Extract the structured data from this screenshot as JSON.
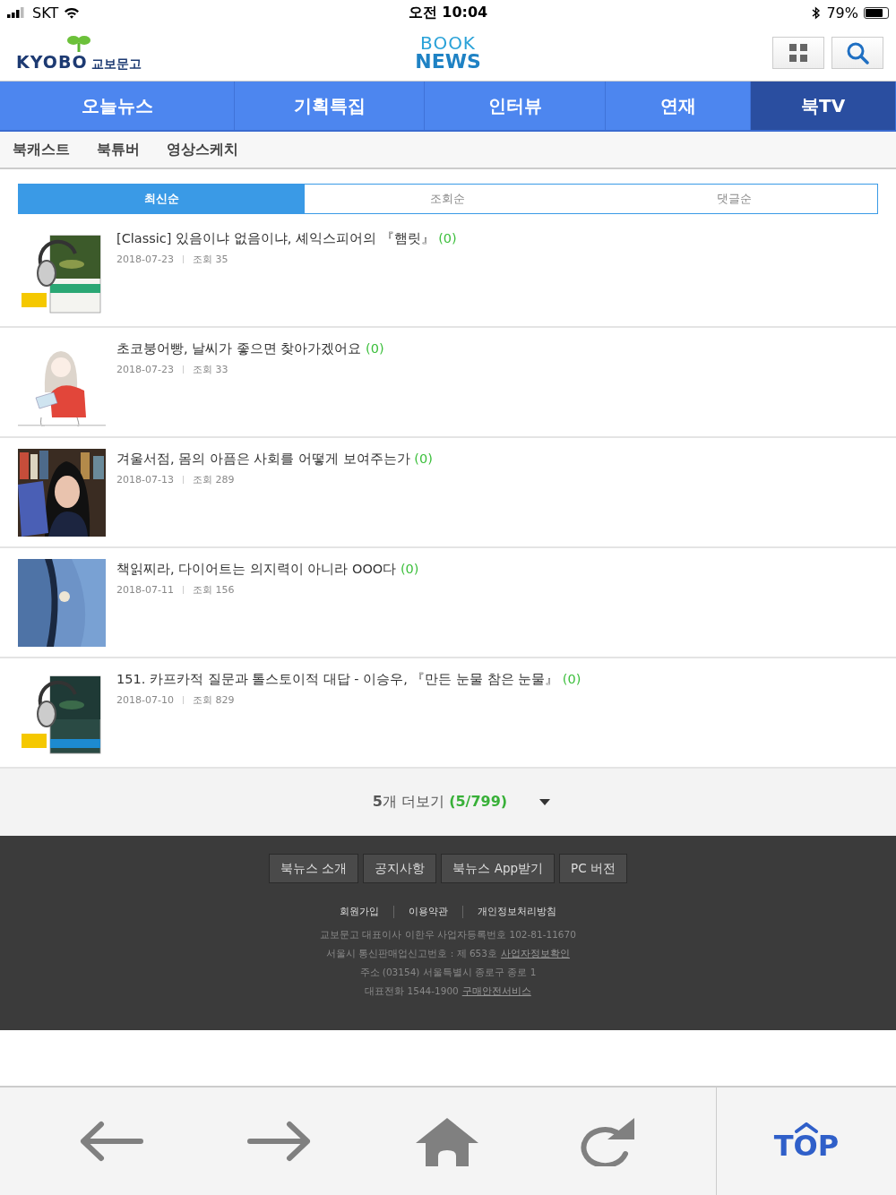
{
  "status_bar": {
    "carrier": "SKT",
    "time": "오전 10:04",
    "battery": "79%"
  },
  "header": {
    "logo_latin": "KYOBO",
    "logo_korean": "교보문고",
    "brand_top": "BOOK",
    "brand_bottom": "NEWS"
  },
  "nav_tabs": [
    {
      "label": "오늘뉴스",
      "selected": false
    },
    {
      "label": "기획특집",
      "selected": false
    },
    {
      "label": "인터뷰",
      "selected": false
    },
    {
      "label": "연재",
      "selected": false
    },
    {
      "label": "북TV",
      "selected": true
    }
  ],
  "sub_tabs": [
    "북캐스트",
    "북튜버",
    "영상스케치"
  ],
  "sort_tabs": [
    {
      "label": "최신순",
      "selected": true
    },
    {
      "label": "조회순",
      "selected": false
    },
    {
      "label": "댓글순",
      "selected": false
    }
  ],
  "articles": [
    {
      "title": "[Classic] 있음이냐 없음이냐, 셰익스피어의 『햄릿』",
      "comments": "(0)",
      "date": "2018-07-23",
      "views": "조회 35"
    },
    {
      "title": "초코붕어빵, 날씨가 좋으면 찾아가겠어요",
      "comments": "(0)",
      "date": "2018-07-23",
      "views": "조회 33"
    },
    {
      "title": "겨울서점, 몸의 아픔은 사회를 어떻게 보여주는가",
      "comments": "(0)",
      "date": "2018-07-13",
      "views": "조회 289"
    },
    {
      "title": "책읽찌라, 다이어트는 의지력이 아니라 OOO다",
      "comments": "(0)",
      "date": "2018-07-11",
      "views": "조회 156"
    },
    {
      "title": "151. 카프카적 질문과 톨스토이적 대답 - 이승우, 『만든 눈물 참은 눈물』",
      "comments": "(0)",
      "date": "2018-07-10",
      "views": "조회 829"
    }
  ],
  "more": {
    "label": "**5**개 더보기",
    "count": "(5/799)"
  },
  "footer": {
    "buttons": [
      "북뉴스 소개",
      "공지사항",
      "북뉴스 App받기",
      "PC 버전"
    ],
    "links": [
      "회원가입",
      "이용약관",
      "개인정보처리방침"
    ],
    "info": [
      {
        "text": "교보문고 대표이사 이한우 사업자등록번호 102-81-11670"
      },
      {
        "text": "서울시 통신판매업신고번호 : 제 653호",
        "link": "사업자정보확인"
      },
      {
        "text": "주소 (03154) 서울특별시 종로구 종로 1"
      },
      {
        "text": "대표전화 1544-1900",
        "link": "구매안전서비스"
      }
    ]
  },
  "toolbar": {
    "top_label": "TOP"
  }
}
